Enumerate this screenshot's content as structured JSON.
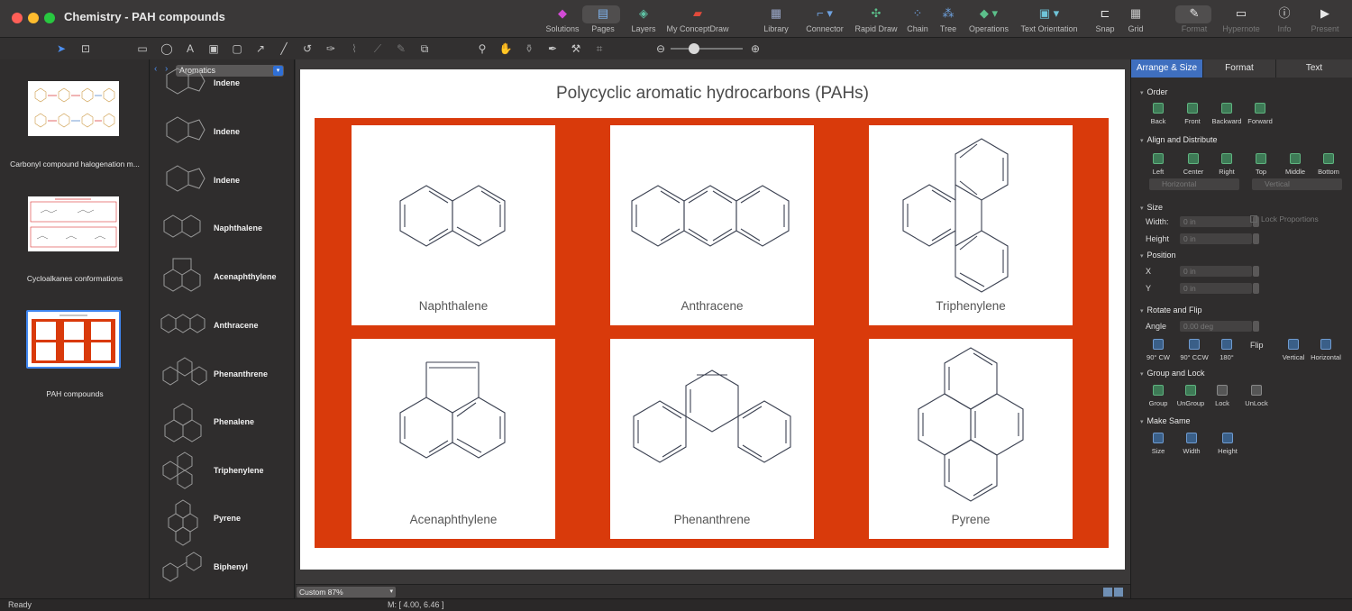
{
  "window": {
    "title": "Chemistry - PAH compounds"
  },
  "toolbar": {
    "items": [
      {
        "label": "Solutions",
        "icon": "solutions-icon"
      },
      {
        "label": "Pages",
        "icon": "pages-icon"
      },
      {
        "label": "Layers",
        "icon": "layers-icon"
      },
      {
        "label": "My ConceptDraw",
        "icon": "conceptdraw-icon"
      },
      {
        "label": "Library",
        "icon": "library-icon"
      },
      {
        "label": "Connector",
        "icon": "connector-icon"
      },
      {
        "label": "Rapid Draw",
        "icon": "rapid-draw-icon"
      },
      {
        "label": "Chain",
        "icon": "chain-icon"
      },
      {
        "label": "Tree",
        "icon": "tree-icon"
      },
      {
        "label": "Operations",
        "icon": "operations-icon"
      },
      {
        "label": "Text Orientation",
        "icon": "text-orientation-icon"
      },
      {
        "label": "Snap",
        "icon": "snap-icon"
      },
      {
        "label": "Grid",
        "icon": "grid-icon"
      },
      {
        "label": "Format",
        "icon": "format-icon"
      },
      {
        "label": "Hypernote",
        "icon": "hypernote-icon"
      },
      {
        "label": "Info",
        "icon": "info-icon"
      },
      {
        "label": "Present",
        "icon": "present-icon"
      }
    ]
  },
  "pages": [
    {
      "label": "Carbonyl compound halogenation m..."
    },
    {
      "label": "Cycloalkanes conformations"
    },
    {
      "label": "PAH compounds"
    }
  ],
  "library": {
    "selected": "Aromatics",
    "items": [
      {
        "label": "Indene"
      },
      {
        "label": "Indene"
      },
      {
        "label": "Indene"
      },
      {
        "label": "Naphthalene"
      },
      {
        "label": "Acenaphthylene"
      },
      {
        "label": "Anthracene"
      },
      {
        "label": "Phenanthrene"
      },
      {
        "label": "Phenalene"
      },
      {
        "label": "Triphenylene"
      },
      {
        "label": "Pyrene"
      },
      {
        "label": "Biphenyl"
      }
    ]
  },
  "diagram": {
    "title": "Polycyclic aromatic hydrocarbons (PAHs)",
    "frame_color": "#d93a0b",
    "compounds": [
      {
        "name": "Naphthalene"
      },
      {
        "name": "Anthracene"
      },
      {
        "name": "Triphenylene"
      },
      {
        "name": "Acenaphthylene"
      },
      {
        "name": "Phenanthrene"
      },
      {
        "name": "Pyrene"
      }
    ]
  },
  "zoom": {
    "value": "Custom 87%"
  },
  "status": {
    "left": "Ready",
    "coords": "M: [ 4.00, 6.46 ]"
  },
  "inspector": {
    "tabs": [
      "Arrange & Size",
      "Format",
      "Text"
    ],
    "active_tab": "Arrange & Size",
    "order": {
      "title": "Order",
      "buttons": [
        "Back",
        "Front",
        "Backward",
        "Forward"
      ]
    },
    "align": {
      "title": "Align and Distribute",
      "buttons": [
        "Left",
        "Center",
        "Right",
        "Top",
        "Middle",
        "Bottom"
      ],
      "horizontal": "Horizontal",
      "vertical": "Vertical"
    },
    "size": {
      "title": "Size",
      "width_label": "Width:",
      "width_value": "0 in",
      "height_label": "Height",
      "height_value": "0 in",
      "lock_label": "Lock Proportions"
    },
    "position": {
      "title": "Position",
      "x_label": "X",
      "x_value": "0 in",
      "y_label": "Y",
      "y_value": "0 in"
    },
    "rotate": {
      "title": "Rotate and Flip",
      "angle_label": "Angle",
      "angle_value": "0.00 deg",
      "buttons": [
        "90° CW",
        "90° CCW",
        "180°"
      ],
      "flip_label": "Flip",
      "flip_buttons": [
        "Vertical",
        "Horizontal"
      ]
    },
    "group": {
      "title": "Group and Lock",
      "buttons": [
        "Group",
        "UnGroup",
        "Lock",
        "UnLock"
      ]
    },
    "same": {
      "title": "Make Same",
      "buttons": [
        "Size",
        "Width",
        "Height"
      ]
    }
  }
}
